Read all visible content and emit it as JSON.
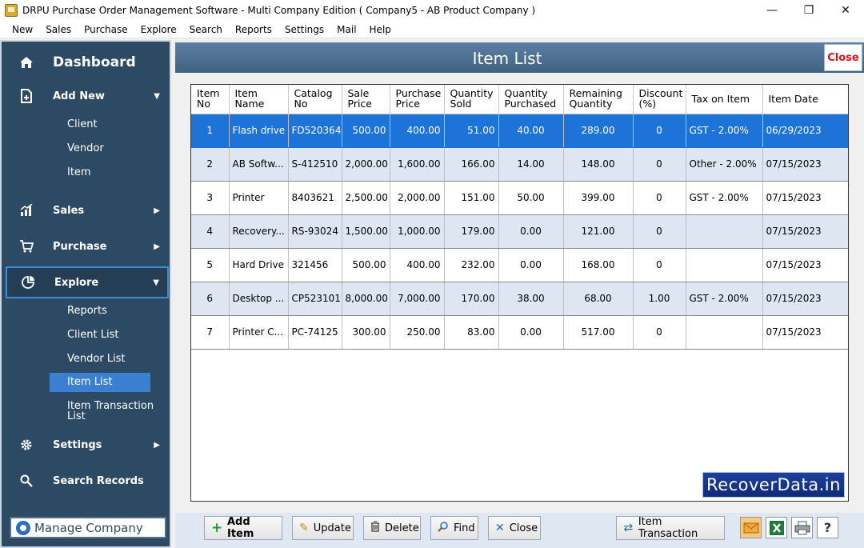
{
  "window": {
    "title": "DRPU Purchase Order Management Software - Multi Company Edition ( Company5 - AB Product Company )",
    "controls": [
      "—",
      "❐",
      "✕"
    ]
  },
  "menu": [
    "New",
    "Sales",
    "Purchase",
    "Explore",
    "Search",
    "Reports",
    "Settings",
    "Mail",
    "Help"
  ],
  "sidebar": {
    "dashboard": "Dashboard",
    "add_new": "Add New",
    "add_new_items": [
      "Client",
      "Vendor",
      "Item"
    ],
    "sales": "Sales",
    "purchase": "Purchase",
    "explore": "Explore",
    "explore_items": [
      "Reports",
      "Client List",
      "Vendor List",
      "Item List",
      "Item Transaction List"
    ],
    "settings": "Settings",
    "search_records": "Search Records",
    "manage_company": "Manage Company"
  },
  "page": {
    "title": "Item List",
    "close_label": "Close"
  },
  "table": {
    "columns": [
      [
        "Item",
        "No"
      ],
      [
        "Item",
        "Name"
      ],
      [
        "Catalog",
        "No"
      ],
      [
        "Sale",
        "Price"
      ],
      [
        "Purchase",
        "Price"
      ],
      [
        "Quantity",
        "Sold"
      ],
      [
        "Quantity",
        "Purchased"
      ],
      [
        "Remaining",
        "Quantity"
      ],
      [
        "Discount",
        "(%)"
      ],
      [
        "Tax on Item",
        ""
      ],
      [
        "Item Date",
        ""
      ]
    ],
    "rows": [
      [
        "1",
        "Flash drive",
        "FD520364",
        "500.00",
        "400.00",
        "51.00",
        "40.00",
        "289.00",
        "0",
        "GST - 2.00%",
        "06/29/2023"
      ],
      [
        "2",
        "AB Softw...",
        "S-412510",
        "2,000.00",
        "1,600.00",
        "166.00",
        "14.00",
        "148.00",
        "0",
        "Other - 2.00%",
        "07/15/2023"
      ],
      [
        "3",
        "Printer",
        "8403621",
        "2,500.00",
        "2,000.00",
        "151.00",
        "50.00",
        "399.00",
        "0",
        "GST - 2.00%",
        "07/15/2023"
      ],
      [
        "4",
        "Recovery...",
        "RS-93024",
        "1,500.00",
        "1,000.00",
        "179.00",
        "0.00",
        "121.00",
        "0",
        "",
        "07/15/2023"
      ],
      [
        "5",
        "Hard Drive",
        "321456",
        "500.00",
        "400.00",
        "232.00",
        "0.00",
        "168.00",
        "0",
        "",
        "07/15/2023"
      ],
      [
        "6",
        "Desktop ...",
        "CP523101",
        "8,000.00",
        "7,000.00",
        "170.00",
        "38.00",
        "68.00",
        "1.00",
        "GST - 2.00%",
        "07/15/2023"
      ],
      [
        "7",
        "Printer C...",
        "PC-74125",
        "300.00",
        "250.00",
        "83.00",
        "0.00",
        "517.00",
        "0",
        "",
        "07/15/2023"
      ]
    ],
    "selected_row": 0
  },
  "watermark": "RecoverData.in",
  "footer": {
    "add_item": "Add Item",
    "update": "Update",
    "delete": "Delete",
    "find": "Find",
    "close": "Close",
    "item_transaction": "Item Transaction"
  },
  "colors": {
    "sidebar_bg": "#2d4a64",
    "selected_row": "#1e73d8",
    "alt_row": "#dde6f1",
    "active_item": "#3a7fd0",
    "close_red": "#d3141a"
  },
  "icons": [
    "home-icon",
    "add-document-icon",
    "chart-icon",
    "cart-icon",
    "explore-icon",
    "gear-icon",
    "search-icon",
    "email-icon",
    "excel-icon",
    "printer-icon",
    "help-icon"
  ]
}
